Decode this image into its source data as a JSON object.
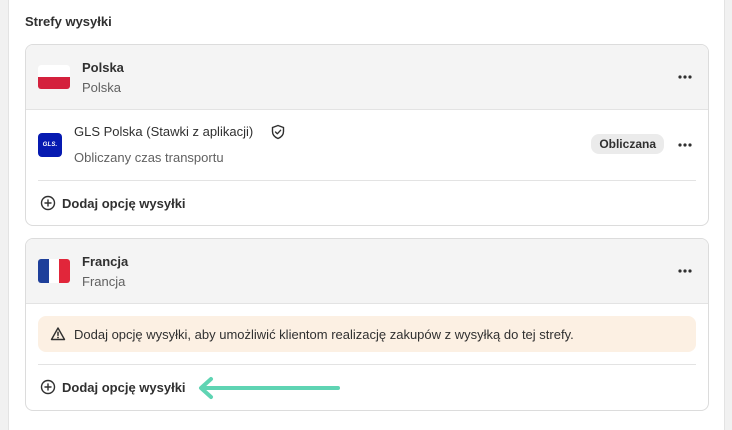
{
  "section": {
    "title": "Strefy wysyłki"
  },
  "zones": [
    {
      "name": "Polska",
      "countries": "Polska",
      "flag": "poland-flag-icon",
      "rates": [
        {
          "name": "GLS Polska (Stawki z aplikacji)",
          "logo_text": "GLS.",
          "description": "Obliczany czas transportu",
          "badge": "Obliczana"
        }
      ],
      "add_label": "Dodaj opcję wysyłki"
    },
    {
      "name": "Francja",
      "countries": "Francja",
      "flag": "france-flag-icon",
      "warning": "Dodaj opcję wysyłki, aby umożliwić klientom realizację zakupów z wysyłką do tej strefy.",
      "add_label": "Dodaj opcję wysyłki"
    }
  ],
  "colors": {
    "warning_bg": "#fcf0e3",
    "annotation_arrow": "#5fd4b3",
    "gls_blue": "#061ab1"
  }
}
